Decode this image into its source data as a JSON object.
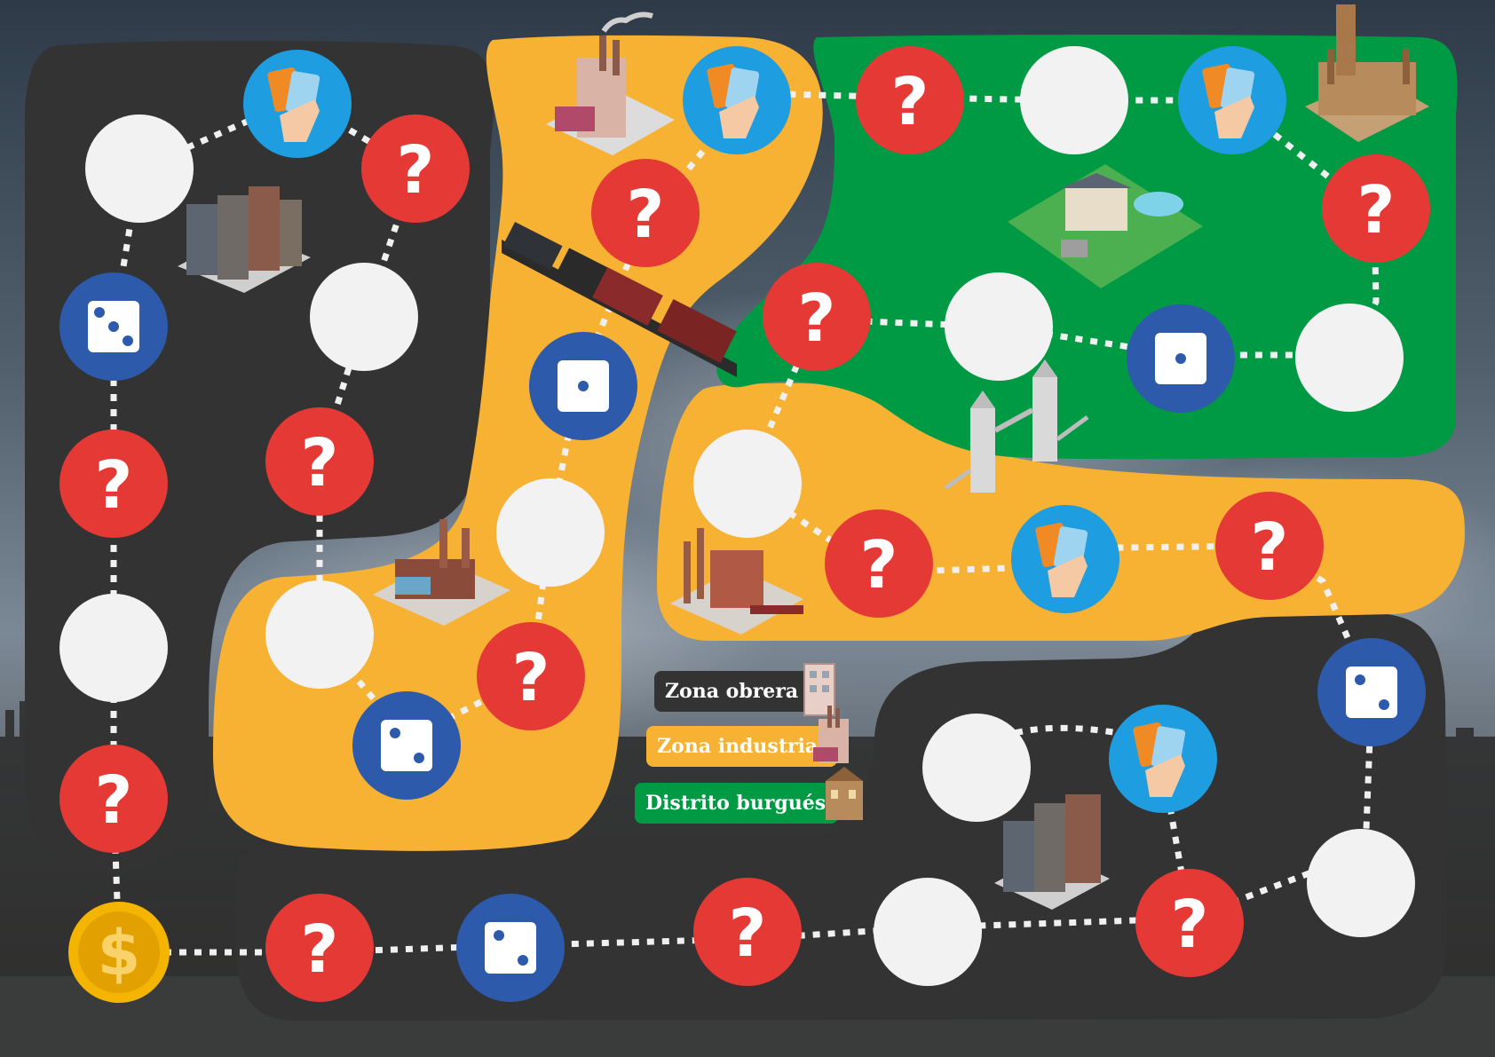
{
  "board": {
    "legend": [
      {
        "label": "Zona obrera",
        "color": "#333333",
        "text_color": "#ffffff"
      },
      {
        "label": "Zona industrial",
        "color": "#f7b133",
        "text_color": "#ffffff"
      },
      {
        "label": "Distrito burgués",
        "color": "#009a44",
        "text_color": "#ffffff"
      }
    ],
    "start_symbol": "$",
    "question_symbol": "?",
    "colors": {
      "zona_obrera": "#333333",
      "zona_industrial": "#f7b133",
      "distrito_burgues": "#009a44",
      "question": "#e53935",
      "dice": "#2e5aac",
      "card": "#1e9de0",
      "empty": "#f2f2f2",
      "start": "#f4b400"
    },
    "icons": [
      "factory-icon",
      "tenement-icon",
      "train-icon",
      "palace-icon",
      "mansion-icon",
      "tower-bridge-icon",
      "card-hand-icon",
      "dice-icon",
      "dollar-coin-icon",
      "question-mark-icon"
    ]
  }
}
